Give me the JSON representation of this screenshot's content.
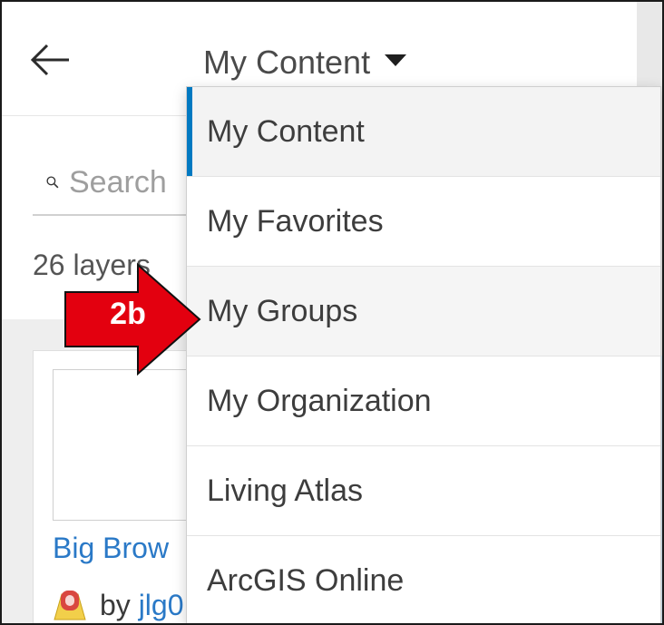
{
  "header": {
    "title": "My Content"
  },
  "search": {
    "placeholder": "Search"
  },
  "results": {
    "count_text": "26 layers"
  },
  "card": {
    "title": "Big Brow",
    "owner_prefix": "by",
    "owner": "jlg0"
  },
  "dropdown": {
    "items": [
      {
        "label": "My Content",
        "selected": true
      },
      {
        "label": "My Favorites",
        "selected": false
      },
      {
        "label": "My Groups",
        "selected": false
      },
      {
        "label": "My Organization",
        "selected": false
      },
      {
        "label": "Living Atlas",
        "selected": false
      },
      {
        "label": "ArcGIS Online",
        "selected": false
      }
    ]
  },
  "annotation": {
    "label": "2b"
  },
  "colors": {
    "accent": "#0079c1",
    "link": "#2a79c7",
    "annotation_red": "#e3000f"
  },
  "icons": {
    "back": "arrow-left-icon",
    "dropdown": "caret-down-icon",
    "search": "search-icon",
    "layer": "layer-icon"
  }
}
